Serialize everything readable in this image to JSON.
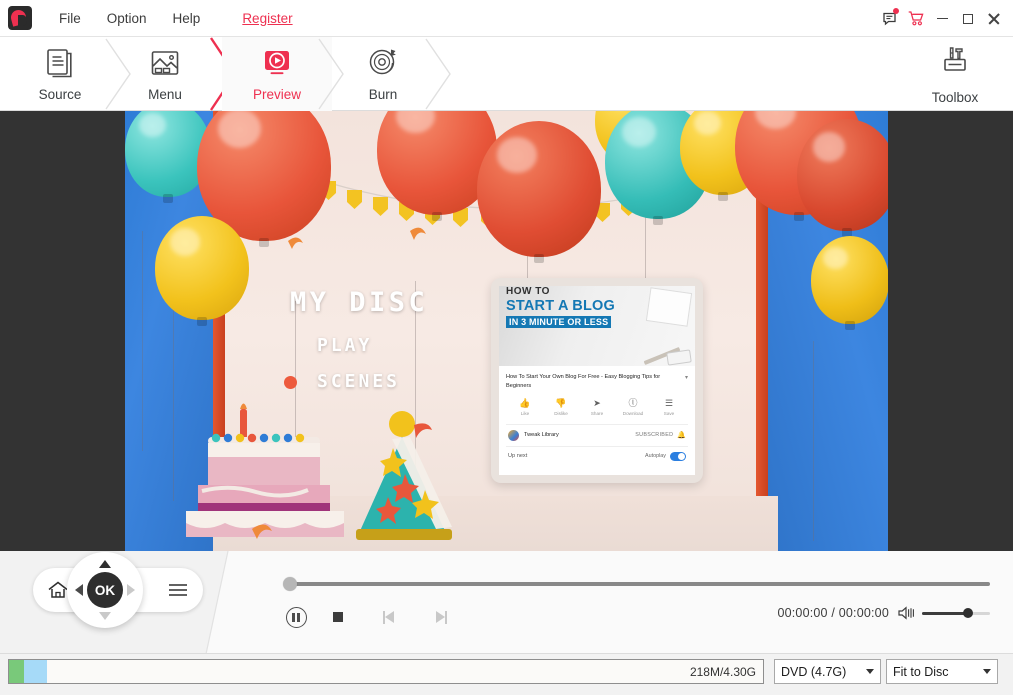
{
  "app": {
    "logo_icon": "app-flame-logo",
    "menu": [
      {
        "label": "File"
      },
      {
        "label": "Option"
      },
      {
        "label": "Help"
      },
      {
        "label": "Register"
      }
    ],
    "window_controls": {
      "feedback_icon": "feedback-message-icon",
      "cart_icon": "shopping-cart-icon",
      "minimize_icon": "minimize-icon",
      "maximize_icon": "maximize-icon",
      "close_icon": "close-icon",
      "badge_color": "#ee3050"
    }
  },
  "steps": [
    {
      "label": "Source",
      "icon": "documents-icon",
      "active": false
    },
    {
      "label": "Menu",
      "icon": "image-template-icon",
      "active": false
    },
    {
      "label": "Preview",
      "icon": "preview-play-monitor-icon",
      "active": true
    },
    {
      "label": "Burn",
      "icon": "disc-burn-icon",
      "active": false
    }
  ],
  "toolbox": {
    "label": "Toolbox",
    "icon": "toolbox-icon"
  },
  "accent_color": "#ee3050",
  "dvd_menu": {
    "title": "MY DISC",
    "items": [
      {
        "label": "PLAY",
        "selected": false
      },
      {
        "label": "SCENES",
        "selected": true
      }
    ],
    "selection_marker_color": "#ed5a3d"
  },
  "inner_video": {
    "hero_line1": "HOW TO",
    "hero_line2": "START A BLOG",
    "hero_line3": "IN 3 MINUTE OR LESS",
    "video_title": "How To Start Your Own Blog For Free - Easy Blogging Tips for Beginners",
    "expand_icon": "chevron-down-icon",
    "actions": [
      {
        "label": "Like",
        "icon": "thumbs-up-icon",
        "glyph": "👍"
      },
      {
        "label": "Dislike",
        "icon": "thumbs-down-icon",
        "glyph": "👎"
      },
      {
        "label": "Share",
        "icon": "share-arrow-icon",
        "glyph": "➤"
      },
      {
        "label": "Download",
        "icon": "download-icon",
        "glyph": "ⓛ"
      },
      {
        "label": "Save",
        "icon": "save-playlist-icon",
        "glyph": "☰"
      }
    ],
    "channel_name": "Tweak Library",
    "subscribed_label": "SUBSCRIBED",
    "bell_icon": "notification-bell-icon",
    "up_next_label": "Up next",
    "autoplay_label": "Autoplay",
    "autoplay_on": true
  },
  "remote": {
    "home_icon": "home-icon",
    "menu_icon": "hamburger-menu-icon",
    "ok_label": "OK",
    "up_icon": "arrow-up-icon",
    "down_icon": "arrow-down-icon",
    "left_icon": "arrow-left-icon",
    "right_icon": "arrow-right-icon"
  },
  "player": {
    "seek_position_percent": 0,
    "pause_icon": "pause-circle-icon",
    "stop_icon": "stop-square-icon",
    "prev_icon": "skip-previous-icon",
    "next_icon": "skip-next-icon",
    "time_display": "00:00:00 / 00:00:00",
    "current_time": "00:00:00",
    "total_time": "00:00:00",
    "volume_icon": "speaker-volume-icon",
    "volume_percent": 68
  },
  "bottom": {
    "disc_usage_text": "218M/4.30G",
    "used_size": "218M",
    "capacity_size": "4.30G",
    "segment_colors": [
      "#79c97a",
      "#a6daf8"
    ],
    "disc_type": {
      "value": "DVD (4.7G)",
      "caret_icon": "chevron-down-icon"
    },
    "fit_mode": {
      "value": "Fit to Disc",
      "caret_icon": "chevron-down-icon"
    }
  }
}
